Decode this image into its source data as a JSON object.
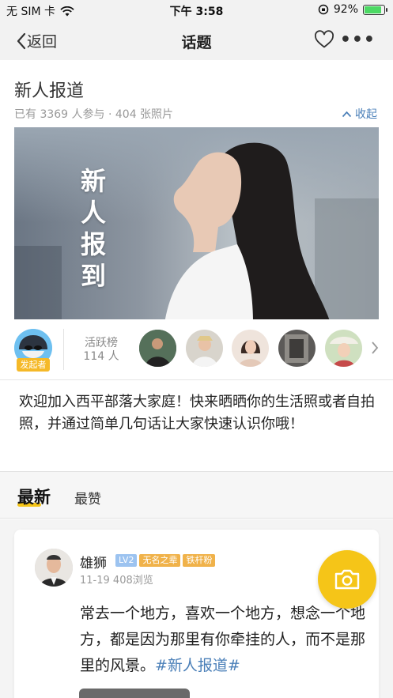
{
  "status_bar": {
    "carrier": "无 SIM 卡",
    "time": "下午 3:58",
    "battery": "92%",
    "battery_level": 0.92
  },
  "nav": {
    "back_label": "返回",
    "title": "话题",
    "more_label": "•••"
  },
  "topic": {
    "title": "新人报道",
    "meta": "已有 3369 人参与 · 404 张照片",
    "collapse_label": "收起",
    "banner_text": "新人报到"
  },
  "active": {
    "founder_badge": "发起者",
    "rank_label": "活跃榜",
    "rank_count": "114 人"
  },
  "description": "欢迎加入西平部落大家庭！快来晒晒你的生活照或者自拍照，并通过简单几句话让大家快速认识你哦！",
  "tabs": {
    "newest": "最新",
    "most_liked": "最赞"
  },
  "post": {
    "author": "雄狮",
    "tags": [
      {
        "text": "LV2",
        "color": "#9cc3f0"
      },
      {
        "text": "无名之辈",
        "color": "#f0b24a"
      },
      {
        "text": "铁杆粉",
        "color": "#f0b24a"
      }
    ],
    "date": "11-19",
    "views": "408浏览",
    "text": "常去一个地方，喜欢一个地方，想念一个地方，都是因为那里有你牵挂的人，而不是那里的风景。",
    "hashtag": "#新人报道#"
  },
  "colors": {
    "accent_yellow": "#f5c518",
    "link_blue": "#4a7fb8"
  }
}
